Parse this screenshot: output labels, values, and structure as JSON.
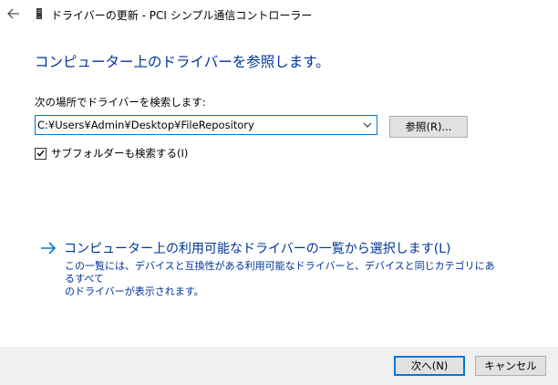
{
  "window": {
    "title": "ドライバーの更新 - PCI シンプル通信コントローラー"
  },
  "page": {
    "heading": "コンピューター上のドライバーを参照します。"
  },
  "search": {
    "label": "次の場所でドライバーを検索します:",
    "path_value": "C:¥Users¥Admin¥Desktop¥FileRepository",
    "browse_label": "参照(R)..."
  },
  "subfolders": {
    "label": "サブフォルダーも検索する(I)",
    "checked": true
  },
  "pick": {
    "title": "コンピューター上の利用可能なドライバーの一覧から選択します(L)",
    "description_line1": "この一覧には、デバイスと互換性がある利用可能なドライバーと、デバイスと同じカテゴリにあるすべて",
    "description_line2": "のドライバーが表示されます。"
  },
  "footer": {
    "next_label": "次へ(N)",
    "cancel_label": "キャンセル"
  },
  "colors": {
    "accent": "#0078d7",
    "heading": "#003399",
    "footer_bg": "#f0f0f0"
  },
  "icons": {
    "back": "back-arrow-icon",
    "window": "device-icon",
    "dropdown": "chevron-down-icon",
    "checkbox": "checkmark-icon",
    "link": "right-arrow-icon"
  }
}
